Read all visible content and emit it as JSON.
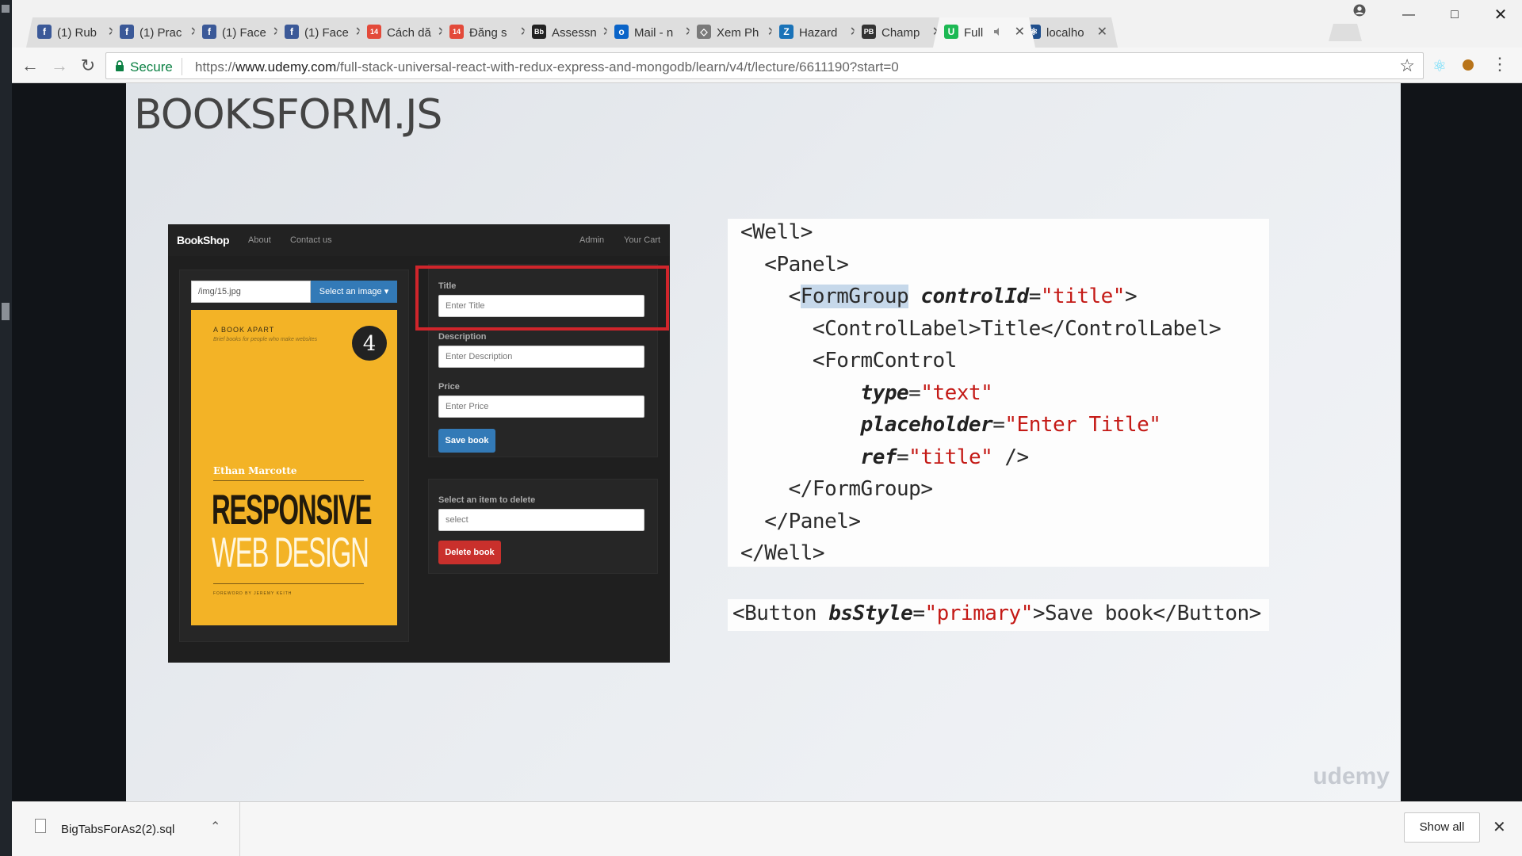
{
  "browser": {
    "tabs": [
      {
        "title": "(1) Rub",
        "favicon": "facebook-icon",
        "color": "#3b5998",
        "glyph": "f"
      },
      {
        "title": "(1) Prac",
        "favicon": "facebook-icon",
        "color": "#3b5998",
        "glyph": "f"
      },
      {
        "title": "(1) Face",
        "favicon": "facebook-icon",
        "color": "#3b5998",
        "glyph": "f"
      },
      {
        "title": "(1) Face",
        "favicon": "facebook-icon",
        "color": "#3b5998",
        "glyph": "f"
      },
      {
        "title": "Cách dă",
        "favicon": "calendar-14-icon",
        "color": "#e34a3a",
        "glyph": "14"
      },
      {
        "title": "Đăng s",
        "favicon": "calendar-14-icon",
        "color": "#e34a3a",
        "glyph": "14"
      },
      {
        "title": "Assessn",
        "favicon": "blackboard-icon",
        "color": "#222222",
        "glyph": "Bb"
      },
      {
        "title": "Mail - n",
        "favicon": "outlook-icon",
        "color": "#0a64c8",
        "glyph": "o"
      },
      {
        "title": "Xem Ph",
        "favicon": "diamond-icon",
        "color": "#7a7a7a",
        "glyph": "◇"
      },
      {
        "title": "Hazard",
        "favicon": "zotero-icon",
        "color": "#1a73b8",
        "glyph": "Z"
      },
      {
        "title": "Champ",
        "favicon": "pb-icon",
        "color": "#333333",
        "glyph": "PB"
      },
      {
        "title": "Full",
        "favicon": "udemy-icon",
        "color": "#1db954",
        "glyph": "U",
        "active": true
      },
      {
        "title": "localho",
        "favicon": "react-icon",
        "color": "#1f4e8c",
        "glyph": "⚛"
      }
    ],
    "secure_label": "Secure",
    "url_prefix": "https://",
    "url_host": "www.udemy.com",
    "url_path": "/full-stack-universal-react-with-redux-express-and-mongodb/learn/v4/t/lecture/6611190?start=0"
  },
  "slide": {
    "title": "BOOKSFORM.JS",
    "watermark": "udemy"
  },
  "app": {
    "brand": "BookShop",
    "nav_about": "About",
    "nav_contact": "Contact us",
    "nav_admin": "Admin",
    "nav_cart": "Your Cart",
    "image_path": "/img/15.jpg",
    "select_image": "Select an image ▾",
    "book_series": "A BOOK APART",
    "book_subtitle": "Brief books for people who make websites",
    "book_number": "4",
    "book_author": "Ethan Marcotte",
    "book_title_1": "RESPONSIVE",
    "book_title_2": "WEB DESIGN",
    "book_foreword": "FOREWORD BY JEREMY KEITH",
    "label_title": "Title",
    "ph_title": "Enter Title",
    "label_description": "Description",
    "ph_description": "Enter Description",
    "label_price": "Price",
    "ph_price": "Enter Price",
    "save_button": "Save book",
    "delete_label": "Select an item to delete",
    "delete_select": "select",
    "delete_button": "Delete book"
  },
  "code": {
    "main_lines": [
      [
        {
          "t": "<Well>",
          "c": "c-tag"
        }
      ],
      [
        {
          "t": "  <Panel>",
          "c": "c-tag"
        }
      ],
      [
        {
          "t": "    <",
          "c": "c-tag"
        },
        {
          "t": "FormGroup",
          "c": "c-tag c-hl"
        },
        {
          "t": " ",
          "c": ""
        },
        {
          "t": "controlId",
          "c": "c-attr"
        },
        {
          "t": "=",
          "c": ""
        },
        {
          "t": "\"title\"",
          "c": "c-str"
        },
        {
          "t": ">",
          "c": "c-tag"
        }
      ],
      [
        {
          "t": "      <ControlLabel>Title</ControlLabel>",
          "c": "c-tag"
        }
      ],
      [
        {
          "t": "      <FormControl",
          "c": "c-tag"
        }
      ],
      [
        {
          "t": "          ",
          "c": ""
        },
        {
          "t": "type",
          "c": "c-attr"
        },
        {
          "t": "=",
          "c": ""
        },
        {
          "t": "\"text\"",
          "c": "c-str"
        }
      ],
      [
        {
          "t": "          ",
          "c": ""
        },
        {
          "t": "placeholder",
          "c": "c-attr"
        },
        {
          "t": "=",
          "c": ""
        },
        {
          "t": "\"Enter Title\"",
          "c": "c-str"
        }
      ],
      [
        {
          "t": "          ",
          "c": ""
        },
        {
          "t": "ref",
          "c": "c-attr"
        },
        {
          "t": "=",
          "c": ""
        },
        {
          "t": "\"title\"",
          "c": "c-str"
        },
        {
          "t": " />",
          "c": "c-tag"
        }
      ],
      [
        {
          "t": "    </",
          "c": "c-tag"
        },
        {
          "t": "FormGroup",
          "c": "c-tag"
        },
        {
          "t": ">",
          "c": "c-tag"
        }
      ],
      [
        {
          "t": "  </Panel>",
          "c": "c-tag"
        }
      ],
      [
        {
          "t": "</Well>",
          "c": "c-tag"
        }
      ]
    ],
    "button_line": [
      {
        "t": "<Button ",
        "c": "c-tag"
      },
      {
        "t": "bsStyle",
        "c": "c-attr"
      },
      {
        "t": "=",
        "c": ""
      },
      {
        "t": "\"primary\"",
        "c": "c-str"
      },
      {
        "t": ">Save book</Button>",
        "c": "c-tag"
      }
    ]
  },
  "downloads": {
    "file_name": "BigTabsForAs2(2).sql",
    "show_all": "Show all"
  },
  "colors": {
    "highlight_border": "#d0252b",
    "save_button": "#337ab7",
    "delete_button": "#c9302c",
    "book_cover": "#f3b326"
  }
}
